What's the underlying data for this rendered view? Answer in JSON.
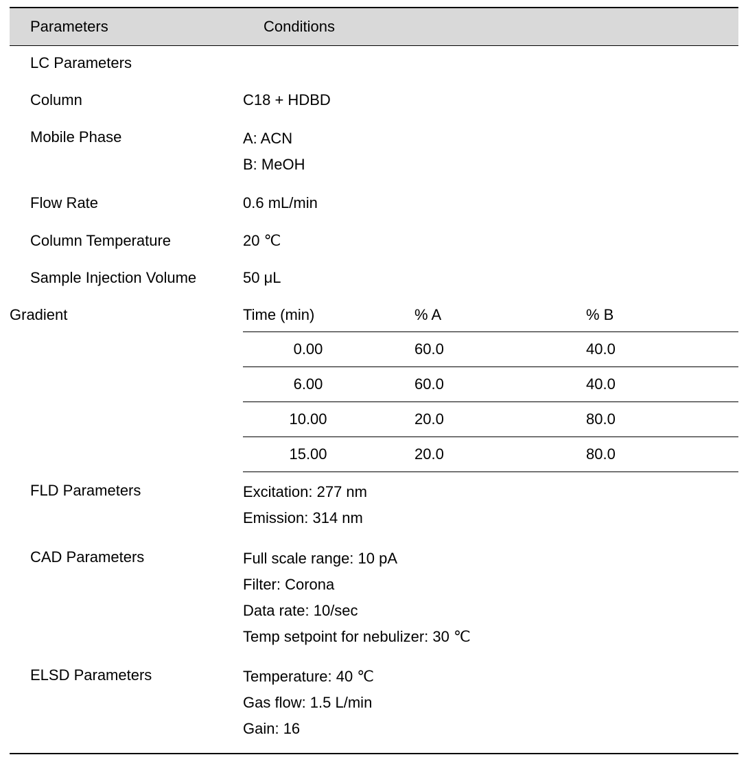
{
  "header": {
    "parameters_label": "Parameters",
    "conditions_label": "Conditions"
  },
  "rows": {
    "lc_parameters_label": "LC Parameters",
    "column": {
      "label": "Column",
      "value": "C18 + HDBD"
    },
    "mobile_phase": {
      "label": "Mobile Phase",
      "line_a": "A: ACN",
      "line_b": "B: MeOH"
    },
    "flow_rate": {
      "label": "Flow Rate",
      "value": "0.6 mL/min"
    },
    "column_temperature": {
      "label": "Column Temperature",
      "value": "20 ℃"
    },
    "sample_injection_volume": {
      "label": "Sample Injection Volume",
      "value": "50 μL"
    },
    "gradient": {
      "label": "Gradient",
      "headers": {
        "time": "Time (min)",
        "a": "% A",
        "b": "% B"
      },
      "steps": [
        {
          "time": "0.00",
          "a": "60.0",
          "b": "40.0"
        },
        {
          "time": "6.00",
          "a": "60.0",
          "b": "40.0"
        },
        {
          "time": "10.00",
          "a": "20.0",
          "b": "80.0"
        },
        {
          "time": "15.00",
          "a": "20.0",
          "b": "80.0"
        }
      ]
    },
    "fld": {
      "label": "FLD Parameters",
      "line1": "Excitation: 277 nm",
      "line2": "Emission: 314 nm"
    },
    "cad": {
      "label": "CAD Parameters",
      "line1": "Full scale range: 10 pA",
      "line2": "Filter: Corona",
      "line3": "Data rate: 10/sec",
      "line4": "Temp setpoint for nebulizer: 30 ℃"
    },
    "elsd": {
      "label": "ELSD Parameters",
      "line1": "Temperature: 40 ℃",
      "line2": "Gas flow: 1.5 L/min",
      "line3": "Gain: 16"
    }
  }
}
